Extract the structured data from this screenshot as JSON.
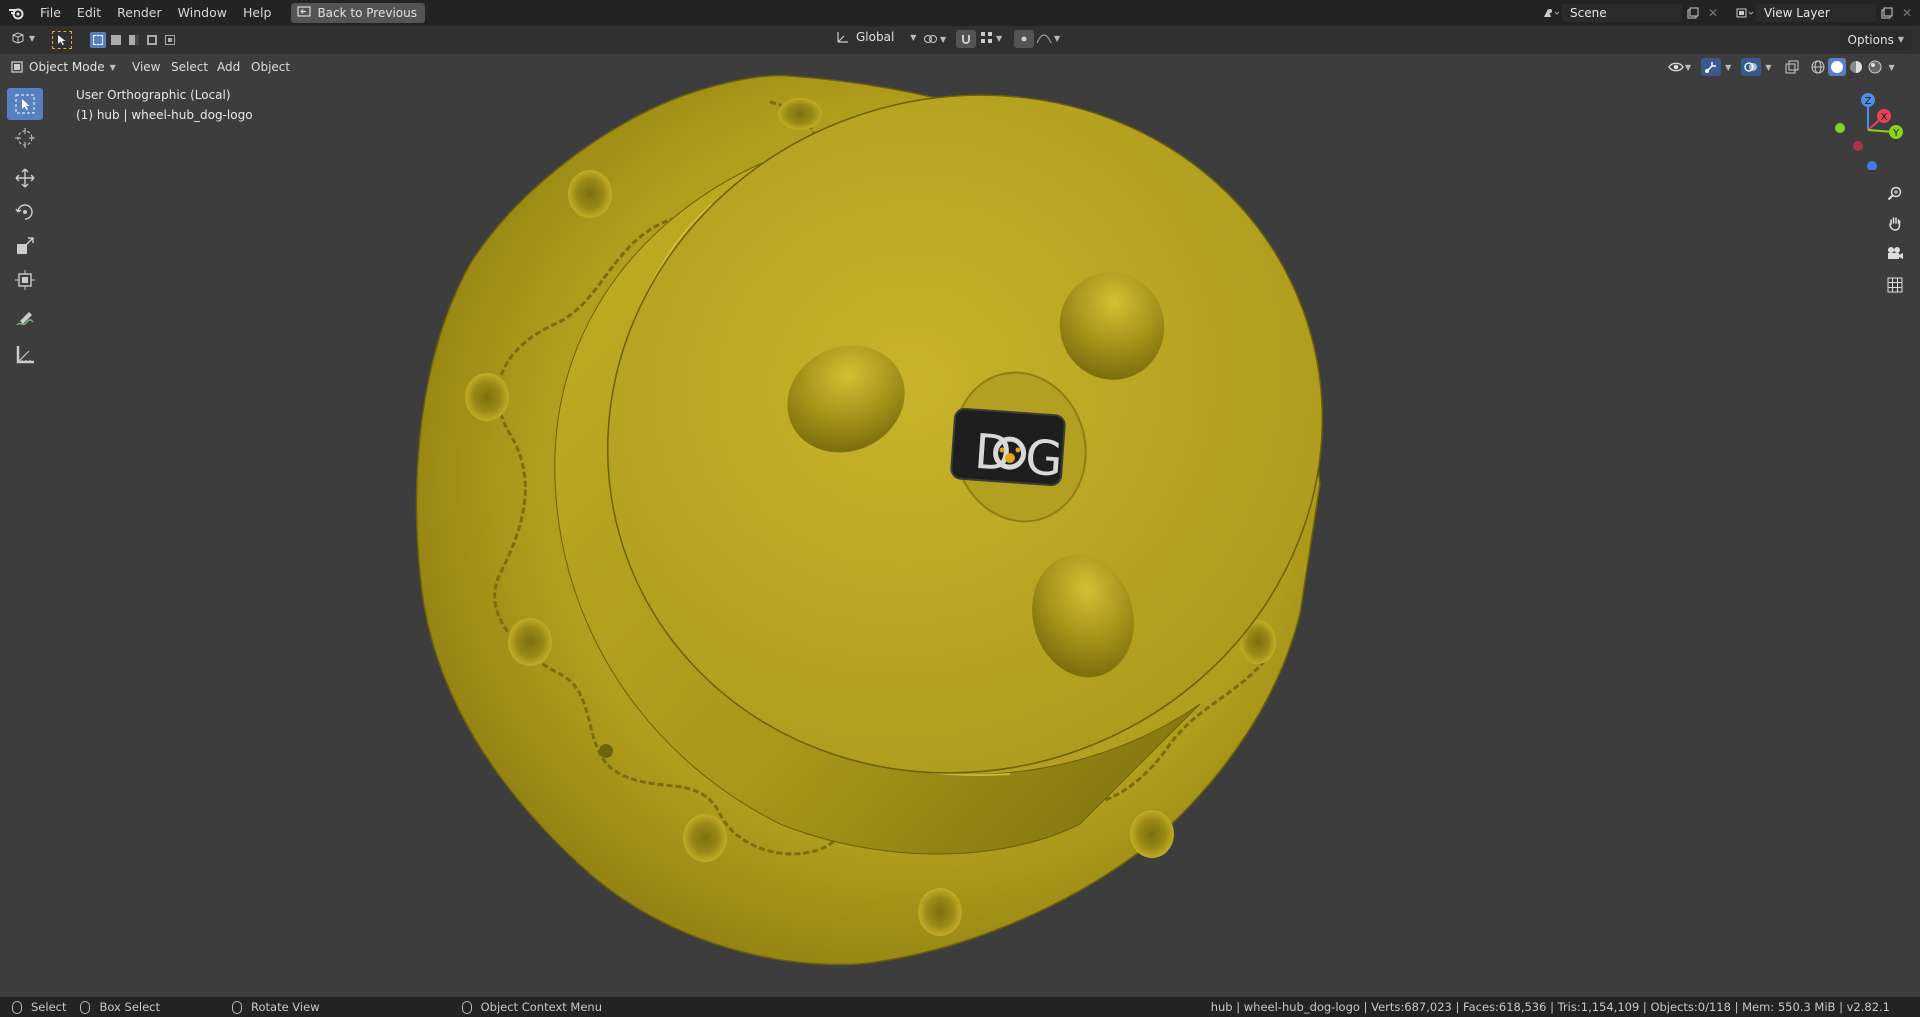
{
  "topbar": {
    "menus": [
      "File",
      "Edit",
      "Render",
      "Window",
      "Help"
    ],
    "back_button": "Back to Previous",
    "scene_name": "Scene",
    "view_layer": "View Layer",
    "options": "Options"
  },
  "viewport_header": {
    "mode": "Object Mode",
    "menus": [
      "View",
      "Select",
      "Add",
      "Object"
    ],
    "orientation": "Global"
  },
  "overlay": {
    "view_name": "User Orthographic (Local)",
    "object_info": "(1) hub | wheel-hub_dog-logo"
  },
  "model": {
    "logo_text_left": "D",
    "logo_text_right": "G",
    "base_color": "#b8a523"
  },
  "gizmo": {
    "z": "Z",
    "x": "X",
    "y": "Y"
  },
  "statusbar": {
    "select": "Select",
    "box_select": "Box Select",
    "rotate_view": "Rotate View",
    "context_menu": "Object Context Menu",
    "stats": "hub | wheel-hub_dog-logo | Verts:687,023 | Faces:618,536 | Tris:1,154,109 | Objects:0/118 | Mem: 550.3 MiB | v2.82.1"
  },
  "colors": {
    "accent": "#5680c2",
    "axis_x": "#e84057",
    "axis_y": "#8bd11f",
    "axis_z": "#4f8ee8"
  }
}
